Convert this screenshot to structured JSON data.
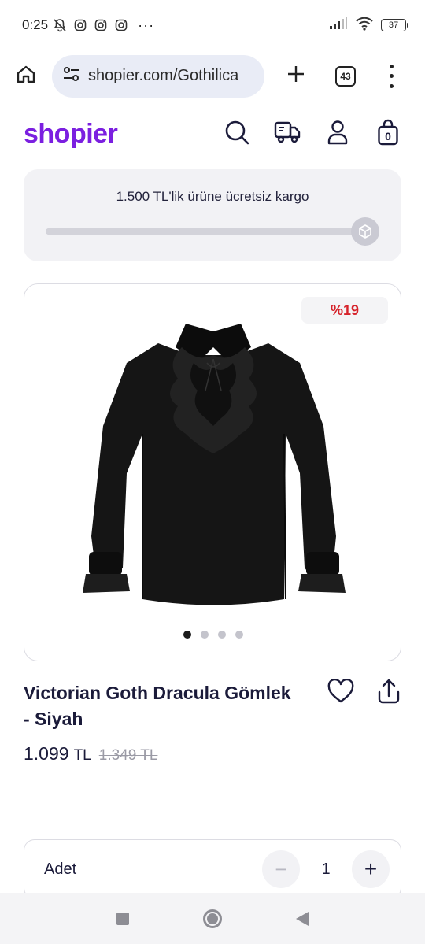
{
  "status_bar": {
    "time": "0:25",
    "battery": "37",
    "more": "···",
    "icons": [
      "bell-off-icon",
      "instagram-icon",
      "instagram-icon",
      "instagram-icon",
      "signal-icon",
      "wifi-icon",
      "battery-icon"
    ]
  },
  "browser": {
    "url": "shopier.com/Gothilica",
    "tab_count": "43",
    "icons": [
      "home-icon",
      "site-settings-icon",
      "plus-icon",
      "tabs-icon",
      "more-vert-icon"
    ]
  },
  "site": {
    "logo": "shopier",
    "brand_color": "#7b1fe0",
    "header_icons": [
      "search-icon",
      "truck-icon",
      "user-icon",
      "bag-icon"
    ],
    "cart_count": "0"
  },
  "shipping": {
    "message": "1.500 TL'lik ürüne ücretsiz kargo",
    "progress_fraction": 1.0,
    "icon": "package-icon"
  },
  "product": {
    "discount": "%19",
    "discount_color": "#d6232b",
    "image_count": 4,
    "active_image": 0,
    "title": "Victorian Goth Dracula Gömlek - Siyah",
    "price": "1.099",
    "currency": "TL",
    "old_price": "1.349 TL",
    "actions": [
      "heart-icon",
      "share-icon"
    ]
  },
  "quantity": {
    "label": "Adet",
    "value": "1",
    "minus": "−",
    "plus": "+"
  }
}
